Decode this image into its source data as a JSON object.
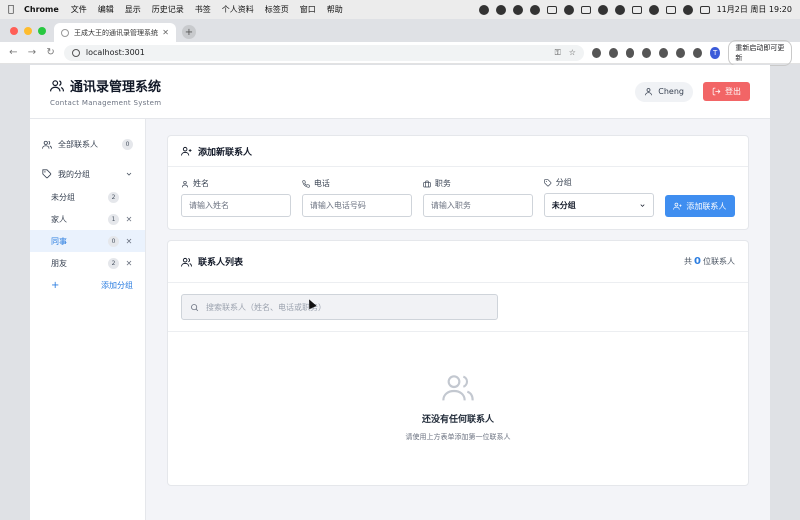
{
  "os_menubar": {
    "app": "Chrome",
    "items": [
      "文件",
      "编辑",
      "显示",
      "历史记录",
      "书签",
      "个人资料",
      "标签页",
      "窗口",
      "帮助"
    ],
    "clock": "11月2日 周日  19:20"
  },
  "browser": {
    "tab_title": "王成大王的通讯录管理系统",
    "url": "localhost:3001",
    "profile_initial": "T",
    "relaunch_label": "重新启动即可更新"
  },
  "app": {
    "title": "通讯录管理系统",
    "subtitle": "Contact Management System",
    "user_name": "Cheng",
    "logout_label": "登出"
  },
  "sidebar": {
    "all_contacts_label": "全部联系人",
    "all_contacts_count": "0",
    "my_groups_label": "我的分组",
    "groups": [
      {
        "label": "未分组",
        "count": "2",
        "removable": false,
        "active": false
      },
      {
        "label": "家人",
        "count": "1",
        "removable": true,
        "active": false
      },
      {
        "label": "同事",
        "count": "0",
        "removable": true,
        "active": true
      },
      {
        "label": "朋友",
        "count": "2",
        "removable": true,
        "active": false
      }
    ],
    "add_group_label": "添加分组"
  },
  "add_form": {
    "title": "添加新联系人",
    "name_label": "姓名",
    "name_placeholder": "请输入姓名",
    "phone_label": "电话",
    "phone_placeholder": "请输入电话号码",
    "position_label": "职务",
    "position_placeholder": "请输入职务",
    "group_label": "分组",
    "group_value": "未分组",
    "submit_label": "添加联系人"
  },
  "contact_list": {
    "title": "联系人列表",
    "total_prefix": "共",
    "total_count": "0",
    "total_suffix": "位联系人",
    "search_placeholder": "搜索联系人（姓名、电话或职务）",
    "empty_title": "还没有任何联系人",
    "empty_subtitle": "请使用上方表单添加第一位联系人"
  },
  "colors": {
    "accent": "#3f8ef0",
    "danger": "#f26566",
    "active_bg": "#eaf2fd"
  }
}
